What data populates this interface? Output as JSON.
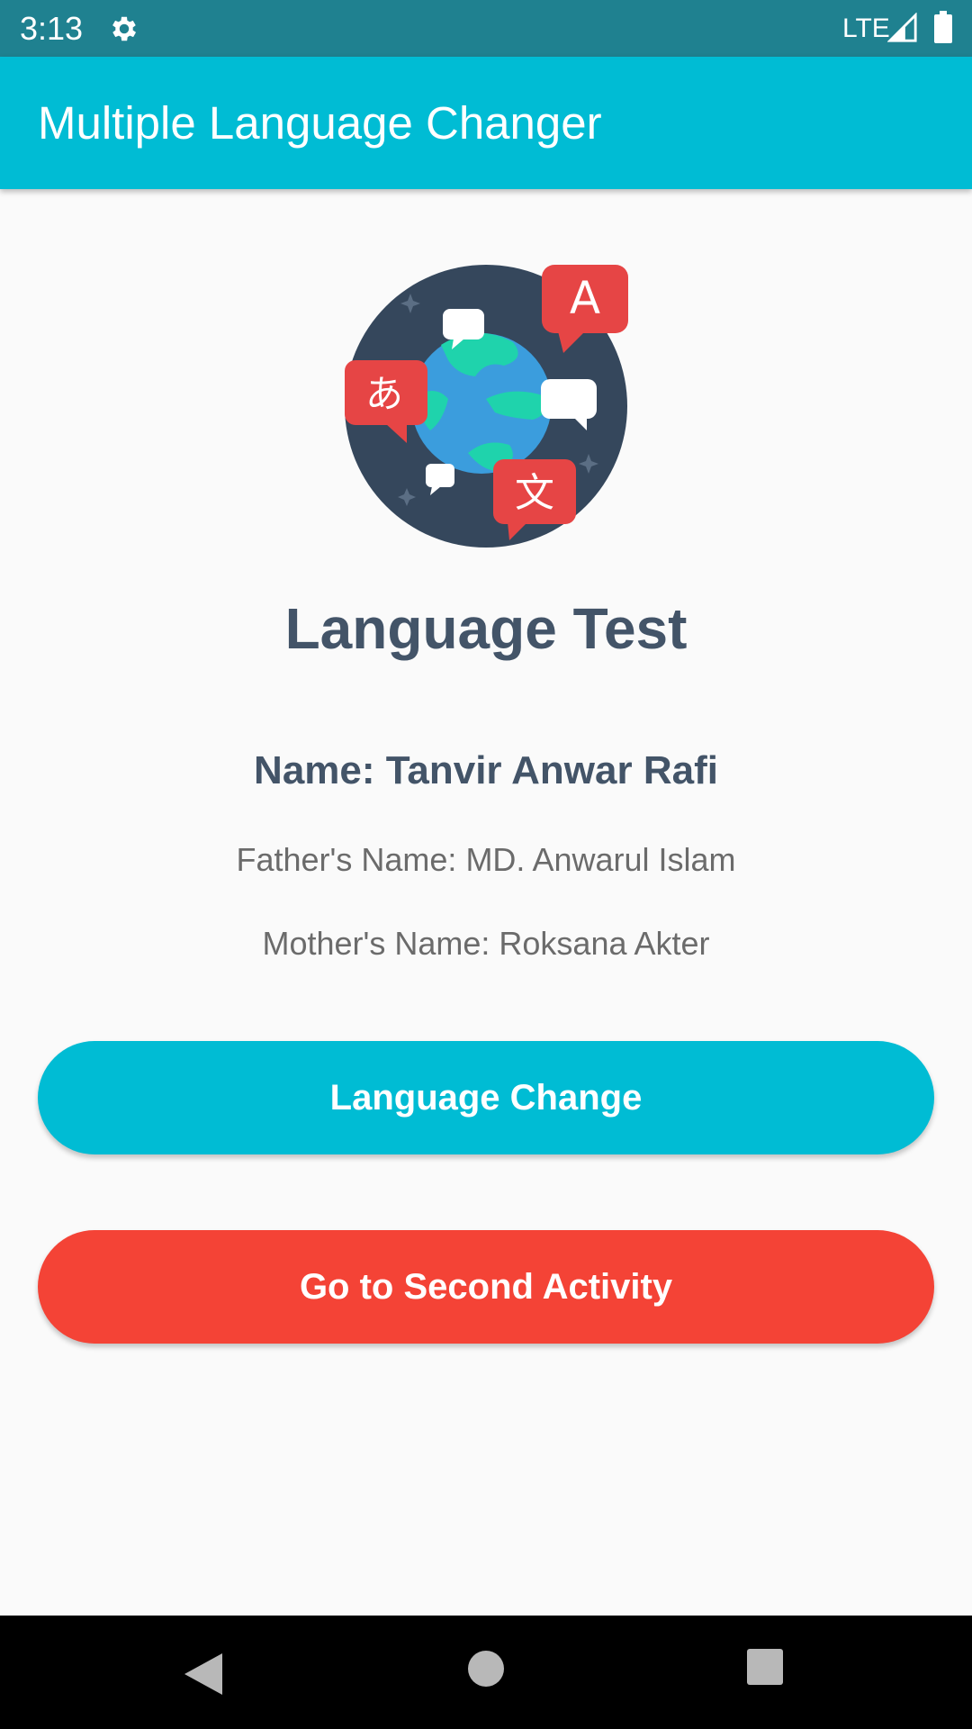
{
  "status_bar": {
    "time": "3:13",
    "network": "LTE",
    "icons": [
      "gear-icon",
      "signal-icon",
      "battery-icon"
    ]
  },
  "app_bar": {
    "title": "Multiple Language Changer"
  },
  "content": {
    "logo_glyphs": {
      "hiragana": "あ",
      "latin": "A",
      "kanji": "文"
    },
    "heading": "Language Test",
    "name": "Name: Tanvir Anwar Rafi",
    "father": "Father's Name: MD. Anwarul Islam",
    "mother": "Mother's Name: Roksana Akter"
  },
  "buttons": {
    "language_change": "Language Change",
    "second_activity": "Go to Second Activity"
  },
  "colors": {
    "status_bar": "#1f8190",
    "app_bar": "#00bcd4",
    "primary_button": "#00bcd4",
    "secondary_button": "#f44336",
    "heading_text": "#435468"
  },
  "nav_bar": {
    "icons": [
      "back-icon",
      "home-icon",
      "recents-icon"
    ]
  }
}
